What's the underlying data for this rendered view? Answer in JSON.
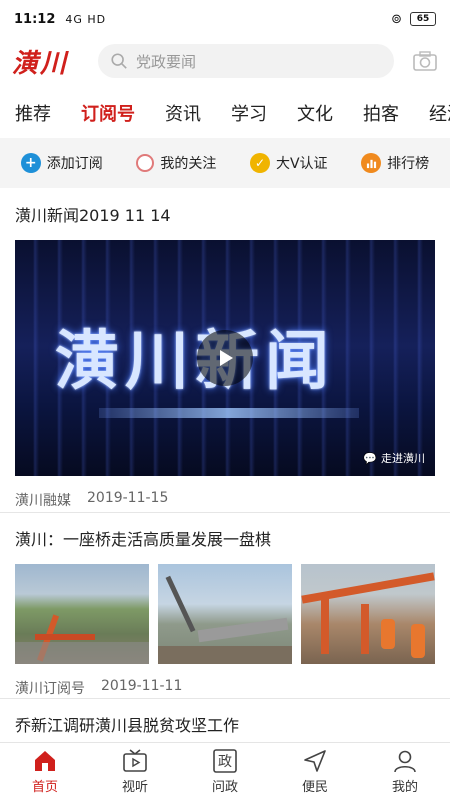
{
  "status": {
    "time": "11:12",
    "signal": "4G  HD",
    "battery": "65"
  },
  "header": {
    "logo": "潢川",
    "search_placeholder": "党政要闻"
  },
  "tabs": [
    "推荐",
    "订阅号",
    "资讯",
    "学习",
    "文化",
    "拍客",
    "经济"
  ],
  "active_tab": "订阅号",
  "actions": [
    {
      "label": "添加订阅",
      "icon": "plus-icon",
      "color": "#1e90d8"
    },
    {
      "label": "我的关注",
      "icon": "circle-icon",
      "color": "#e07a7a"
    },
    {
      "label": "大V认证",
      "icon": "check-icon",
      "color": "#f0b400"
    },
    {
      "label": "排行榜",
      "icon": "bar-chart-icon",
      "color": "#f08a1e"
    }
  ],
  "articles": [
    {
      "title": "潢川新闻2019 11 14",
      "video_text": "潢川新闻",
      "watermark": "走进潢川",
      "source": "潢川融媒",
      "date": "2019-11-15"
    },
    {
      "title": "潢川：一座桥走活高质量发展一盘棋",
      "source": "潢川订阅号",
      "date": "2019-11-11"
    },
    {
      "title": "乔新江调研潢川县脱贫攻坚工作"
    }
  ],
  "nav": [
    {
      "label": "首页",
      "icon": "home-icon",
      "active": true
    },
    {
      "label": "视听",
      "icon": "tv-icon",
      "active": false
    },
    {
      "label": "问政",
      "icon": "zheng-icon",
      "glyph": "政",
      "active": false
    },
    {
      "label": "便民",
      "icon": "send-icon",
      "active": false
    },
    {
      "label": "我的",
      "icon": "user-icon",
      "active": false
    }
  ],
  "colors": {
    "accent": "#d0201c",
    "bar_bg": "#f4f4f4"
  }
}
